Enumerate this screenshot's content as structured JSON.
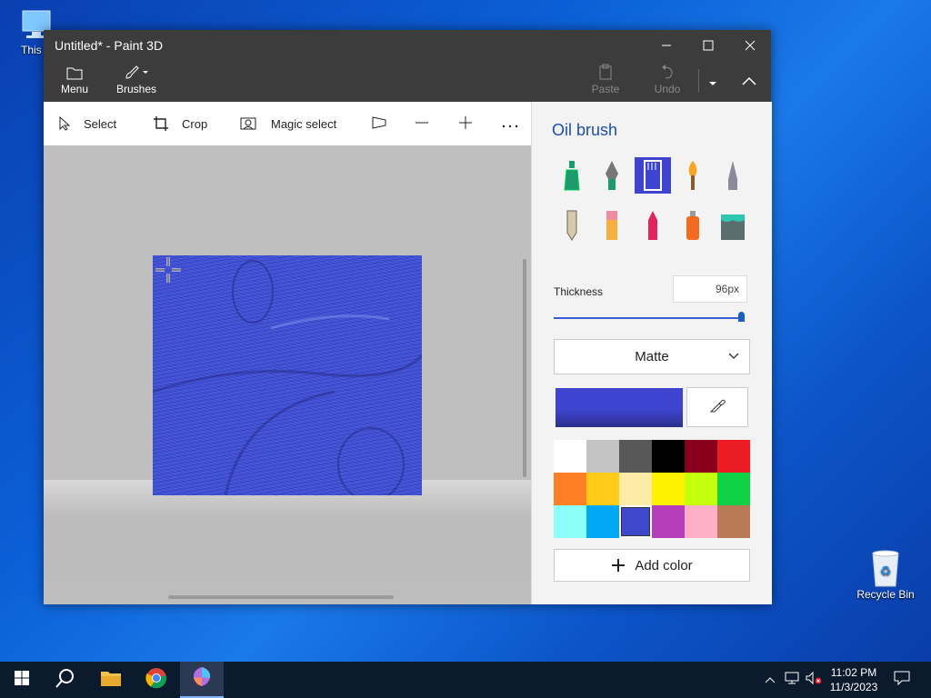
{
  "desktop": {
    "this_pc_label": "This P",
    "recycle_bin_label": "Recycle Bin"
  },
  "window": {
    "title": "Untitled* - Paint 3D"
  },
  "ribbon": {
    "menu_label": "Menu",
    "brushes_label": "Brushes",
    "paste_label": "Paste",
    "undo_label": "Undo"
  },
  "toolbar": {
    "select_label": "Select",
    "crop_label": "Crop",
    "magic_select_label": "Magic select"
  },
  "panel": {
    "title": "Oil brush",
    "brushes": [
      "marker",
      "calligraphy-pen",
      "oil-brush",
      "watercolor",
      "pixel-pen",
      "pencil",
      "eraser",
      "crayon",
      "spray-can",
      "fill"
    ],
    "selected_brush": "oil-brush",
    "thickness_label": "Thickness",
    "thickness_value": "96px",
    "thickness_fraction": 1.0,
    "finish": "Matte",
    "current_color": "#3e44d0",
    "palette": [
      "#ffffff",
      "#c3c3c3",
      "#585858",
      "#000000",
      "#88001b",
      "#ec1c24",
      "#ff7f27",
      "#ffca18",
      "#fdeca6",
      "#fff200",
      "#c4ff0e",
      "#0ed145",
      "#8cfffb",
      "#00a8f3",
      "#3f48cc",
      "#b83dba",
      "#ffaec8",
      "#b97a56"
    ],
    "selected_palette_index": 14,
    "add_color_label": "Add color"
  },
  "taskbar": {
    "time": "11:02 PM",
    "date": "11/3/2023"
  }
}
